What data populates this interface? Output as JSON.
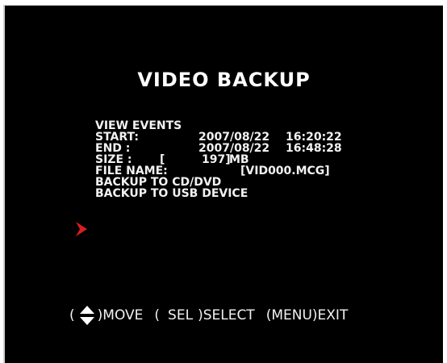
{
  "title": "VIDEO BACKUP",
  "menu": {
    "view_events": "VIEW EVENTS",
    "start_label": "START:",
    "start_date": "2007/08/22",
    "start_time": "16:20:22",
    "end_label": "END :",
    "end_date": "2007/08/22",
    "end_time": "16:48:28",
    "size_label": "SIZE :",
    "size_open": "[",
    "size_value": "197]",
    "size_unit": "MB",
    "file_name_label": "FILE NAME:",
    "file_name_value": "[VID000.MCG]",
    "backup_cd": "BACKUP TO CD/DVD",
    "backup_usb": "BACKUP TO USB DEVICE"
  },
  "footer": {
    "open1": "(",
    "move": ")MOVE",
    "open2": "(",
    "sel": "SEL",
    "select": ")SELECT",
    "menu_key": "(MENU)",
    "exit": "EXIT"
  },
  "colors": {
    "background": "#000000",
    "text": "#f2f2f2",
    "selector_arrow": "#d81e1e"
  },
  "icons": {
    "selector": "selector-arrow-icon",
    "updown": "up-down-arrow-icon"
  }
}
